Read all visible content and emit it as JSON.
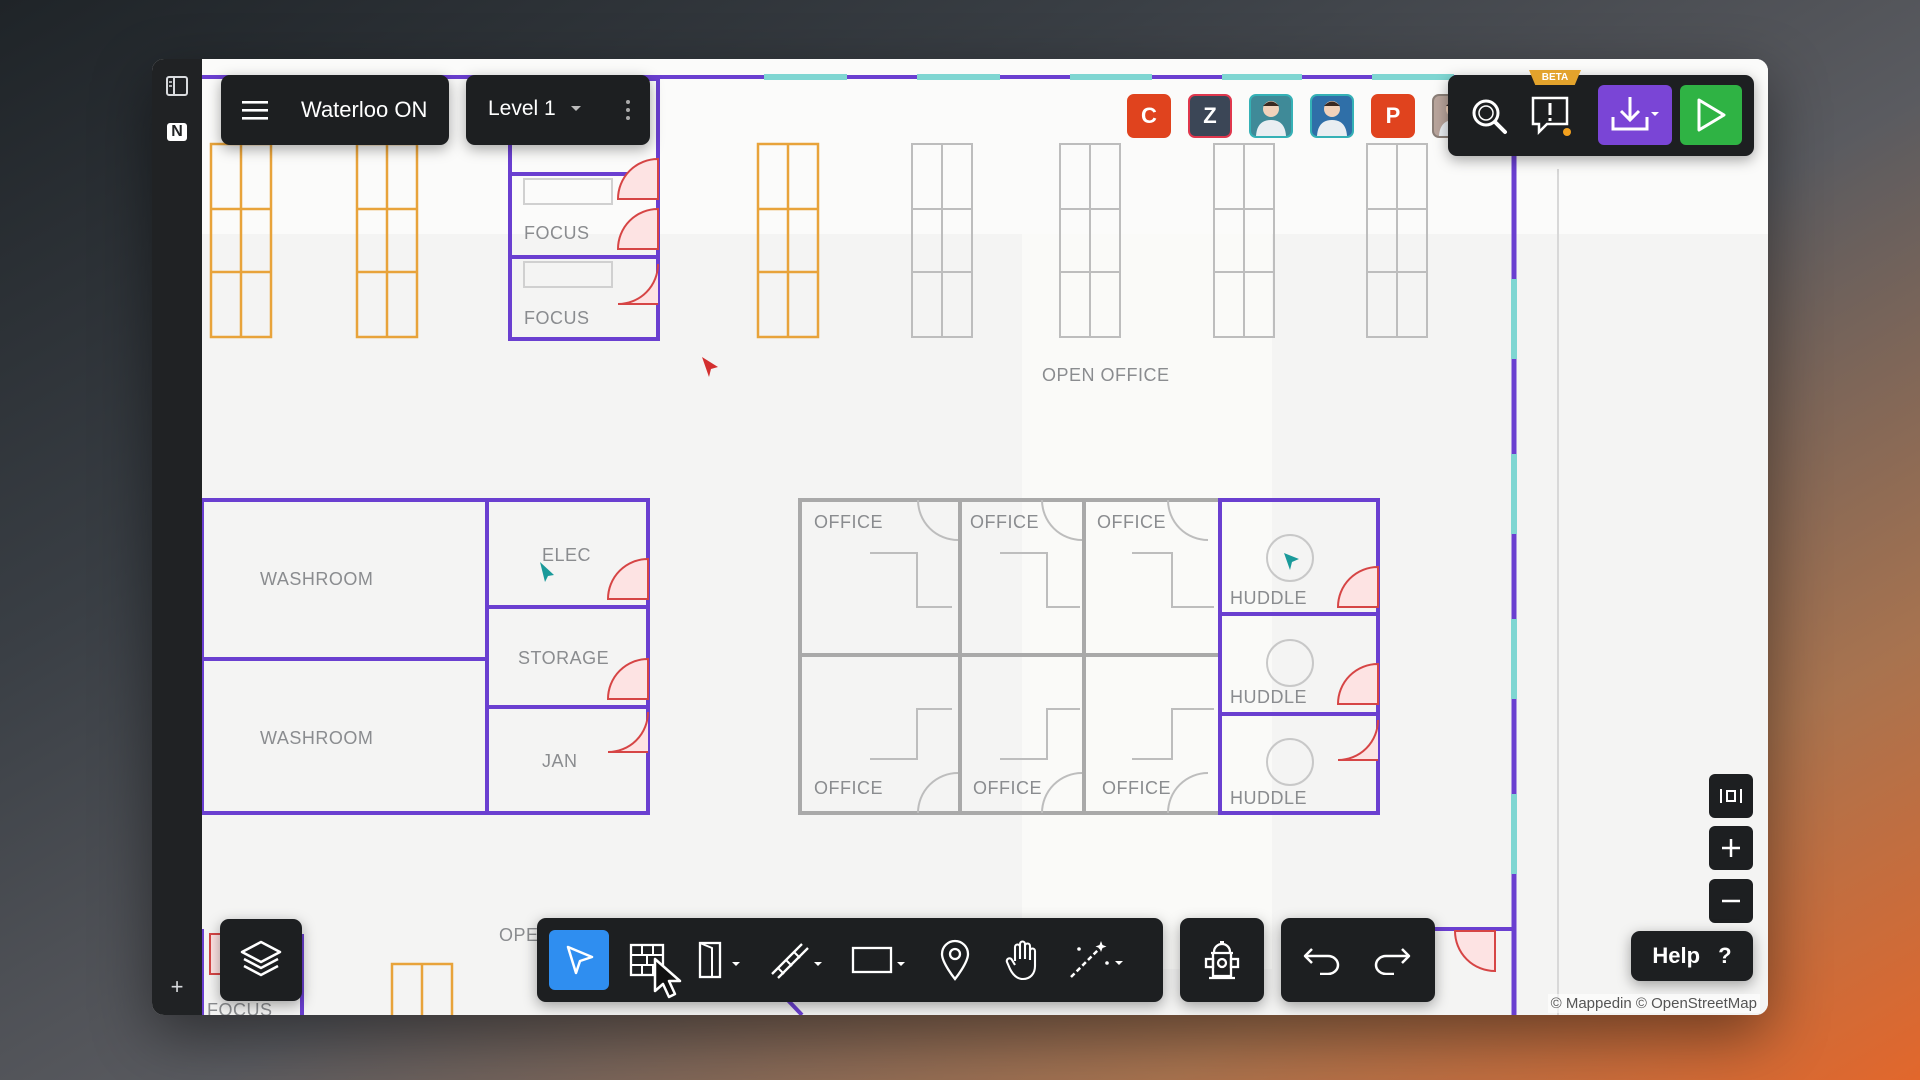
{
  "header": {
    "location_name": "Waterloo ON",
    "level_label": "Level 1",
    "beta_badge": "BETA"
  },
  "collaborators": [
    {
      "initial": "C",
      "color": "#e0431e",
      "border": "#e0431e"
    },
    {
      "initial": "Z",
      "color": "#3b4656",
      "border": "#e0374d"
    },
    {
      "initial": "",
      "color": "#3f8a98",
      "border": "#35b1b6"
    },
    {
      "initial": "",
      "color": "#2f6fa8",
      "border": "#35b1b6"
    },
    {
      "initial": "P",
      "color": "#e0431e",
      "border": "#e0431e"
    },
    {
      "initial": "",
      "color": "#b9a59c",
      "border": "#8b7f78"
    }
  ],
  "rooms": {
    "focus_1": "FOCUS",
    "focus_2": "FOCUS",
    "focus_3": "FOCUS",
    "focus_bottom": "FOCUS",
    "open_office": "OPEN OFFICE",
    "open_office_bottom": "OPE",
    "washroom_1": "WASHROOM",
    "washroom_2": "WASHROOM",
    "elec": "ELEC",
    "storage": "STORAGE",
    "jan": "JAN",
    "office_1": "OFFICE",
    "office_2": "OFFICE",
    "office_3": "OFFICE",
    "office_4": "OFFICE",
    "office_5": "OFFICE",
    "office_6": "OFFICE",
    "huddle_1": "HUDDLE",
    "huddle_2": "HUDDLE",
    "huddle_3": "HUDDLE"
  },
  "help": {
    "label": "Help",
    "icon": "?"
  },
  "attribution": "© Mappedin © OpenStreetMap",
  "colors": {
    "wall_purple": "#6a3fd0",
    "door_red": "#d64545",
    "desk_orange": "#e8a33a",
    "select_blue": "#2f8ef0",
    "play_green": "#2fb344",
    "download_purple": "#7a45d6"
  },
  "icons": {
    "sidebar_toggle": "sidebar-icon",
    "logo": "N",
    "add": "+",
    "menu": "hamburger-icon",
    "more": "kebab-icon",
    "search": "search-icon",
    "feedback": "feedback-icon",
    "download": "download-icon",
    "play": "play-icon"
  }
}
